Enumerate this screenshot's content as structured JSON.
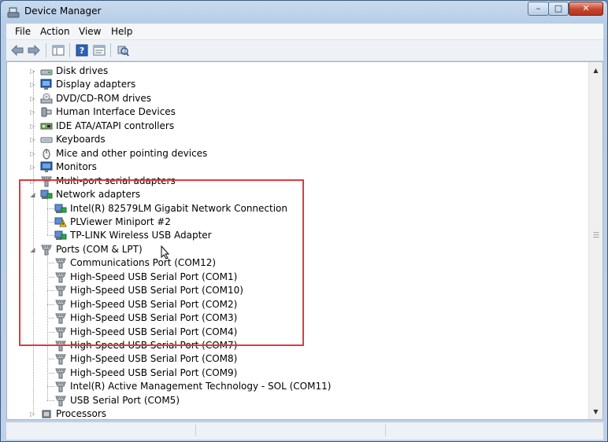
{
  "window": {
    "title": "Device Manager",
    "controls": {
      "minimize": "–",
      "maximize": "□",
      "close": "✕"
    }
  },
  "menu": [
    "File",
    "Action",
    "View",
    "Help"
  ],
  "toolbar": [
    "back-icon",
    "forward-icon",
    "show-hide-console-tree-icon",
    "help-icon",
    "properties-icon",
    "scan-hardware-icon"
  ],
  "tree": [
    {
      "label": "Disk drives",
      "icon": "disk-drive-icon",
      "level": 1,
      "expander": "collapsed"
    },
    {
      "label": "Display adapters",
      "icon": "display-adapter-icon",
      "level": 1,
      "expander": "collapsed"
    },
    {
      "label": "DVD/CD-ROM drives",
      "icon": "dvd-drive-icon",
      "level": 1,
      "expander": "collapsed"
    },
    {
      "label": "Human Interface Devices",
      "icon": "hid-icon",
      "level": 1,
      "expander": "collapsed"
    },
    {
      "label": "IDE ATA/ATAPI controllers",
      "icon": "ide-controller-icon",
      "level": 1,
      "expander": "collapsed"
    },
    {
      "label": "Keyboards",
      "icon": "keyboard-icon",
      "level": 1,
      "expander": "collapsed"
    },
    {
      "label": "Mice and other pointing devices",
      "icon": "mouse-icon",
      "level": 1,
      "expander": "collapsed"
    },
    {
      "label": "Monitors",
      "icon": "monitor-icon",
      "level": 1,
      "expander": "collapsed"
    },
    {
      "label": "Multi-port serial adapters",
      "icon": "port-icon",
      "level": 1,
      "expander": "collapsed"
    },
    {
      "label": "Network adapters",
      "icon": "network-adapter-icon",
      "level": 1,
      "expander": "expanded"
    },
    {
      "label": "Intel(R) 82579LM Gigabit Network Connection",
      "icon": "network-adapter-icon",
      "level": 2
    },
    {
      "label": "PLViewer Miniport #2",
      "icon": "network-adapter-warning-icon",
      "level": 2
    },
    {
      "label": "TP-LINK Wireless USB Adapter",
      "icon": "network-adapter-icon",
      "level": 2
    },
    {
      "label": "Ports (COM & LPT)",
      "icon": "port-icon",
      "level": 1,
      "expander": "expanded"
    },
    {
      "label": "Communications Port (COM12)",
      "icon": "port-icon",
      "level": 2
    },
    {
      "label": "High-Speed USB Serial Port (COM1)",
      "icon": "port-icon",
      "level": 2
    },
    {
      "label": "High-Speed USB Serial Port (COM10)",
      "icon": "port-icon",
      "level": 2
    },
    {
      "label": "High-Speed USB Serial Port (COM2)",
      "icon": "port-icon",
      "level": 2
    },
    {
      "label": "High-Speed USB Serial Port (COM3)",
      "icon": "port-icon",
      "level": 2
    },
    {
      "label": "High-Speed USB Serial Port (COM4)",
      "icon": "port-icon",
      "level": 2
    },
    {
      "label": "High-Speed USB Serial Port (COM7)",
      "icon": "port-icon",
      "level": 2
    },
    {
      "label": "High-Speed USB Serial Port (COM8)",
      "icon": "port-icon",
      "level": 2
    },
    {
      "label": "High-Speed USB Serial Port (COM9)",
      "icon": "port-icon",
      "level": 2
    },
    {
      "label": "Intel(R) Active Management Technology - SOL (COM11)",
      "icon": "port-icon",
      "level": 2
    },
    {
      "label": "USB Serial Port (COM5)",
      "icon": "port-icon",
      "level": 2
    },
    {
      "label": "Processors",
      "icon": "processor-icon",
      "level": 1,
      "expander": "collapsed"
    }
  ],
  "colors": {
    "highlight": "#e03a3e",
    "accent": "#1e5fb4"
  }
}
